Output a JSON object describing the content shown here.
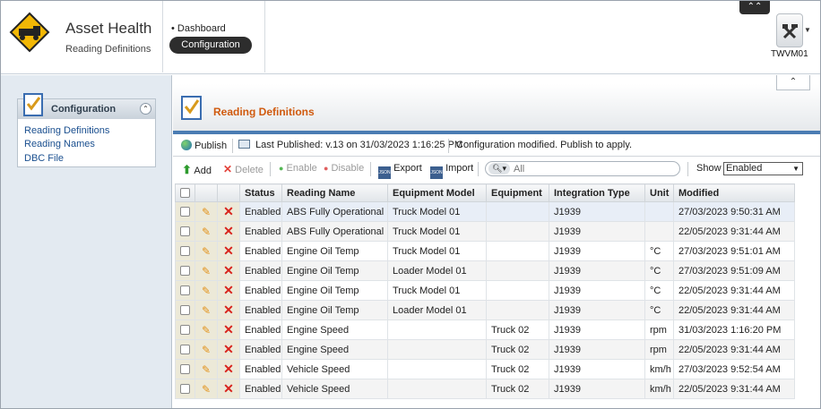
{
  "header": {
    "app_title": "Asset Health",
    "app_subtitle": "Reading Definitions",
    "nav": [
      {
        "label": "Dashboard"
      },
      {
        "label": "Configuration"
      }
    ],
    "collapse_icon": "chevron-double-up-icon",
    "user": {
      "name": "TWVM01",
      "icon": "tools-icon"
    }
  },
  "sidebar": {
    "title": "Configuration",
    "links": [
      {
        "label": "Reading Definitions"
      },
      {
        "label": "Reading Names"
      },
      {
        "label": "DBC File"
      }
    ]
  },
  "main": {
    "title": "Reading Definitions",
    "publish_bar": {
      "publish_label": "Publish",
      "last_published": "Last Published: v.13 on 31/03/2023 1:16:25 PM",
      "status_message": "Configuration modified. Publish to apply."
    },
    "toolbar": {
      "add": "Add",
      "delete": "Delete",
      "enable": "Enable",
      "disable": "Disable",
      "export": "Export",
      "import": "Import",
      "search_placeholder": "All",
      "show_label": "Show",
      "show_value": "Enabled"
    },
    "table": {
      "columns": [
        "Status",
        "Reading Name",
        "Equipment Model",
        "Equipment",
        "Integration Type",
        "Unit",
        "Modified"
      ],
      "rows": [
        {
          "status": "Enabled",
          "name": "ABS Fully Operational",
          "model": "Truck Model 01",
          "equipment": "",
          "type": "J1939",
          "unit": "",
          "modified": "27/03/2023 9:50:31 AM"
        },
        {
          "status": "Enabled",
          "name": "ABS Fully Operational",
          "model": "Truck Model 01",
          "equipment": "",
          "type": "J1939",
          "unit": "",
          "modified": "22/05/2023 9:31:44 AM"
        },
        {
          "status": "Enabled",
          "name": "Engine Oil Temp",
          "model": "Truck Model 01",
          "equipment": "",
          "type": "J1939",
          "unit": "°C",
          "modified": "27/03/2023 9:51:01 AM"
        },
        {
          "status": "Enabled",
          "name": "Engine Oil Temp",
          "model": "Loader Model 01",
          "equipment": "",
          "type": "J1939",
          "unit": "°C",
          "modified": "27/03/2023 9:51:09 AM"
        },
        {
          "status": "Enabled",
          "name": "Engine Oil Temp",
          "model": "Truck Model 01",
          "equipment": "",
          "type": "J1939",
          "unit": "°C",
          "modified": "22/05/2023 9:31:44 AM"
        },
        {
          "status": "Enabled",
          "name": "Engine Oil Temp",
          "model": "Loader Model 01",
          "equipment": "",
          "type": "J1939",
          "unit": "°C",
          "modified": "22/05/2023 9:31:44 AM"
        },
        {
          "status": "Enabled",
          "name": "Engine Speed",
          "model": "",
          "equipment": "Truck 02",
          "type": "J1939",
          "unit": "rpm",
          "modified": "31/03/2023 1:16:20 PM"
        },
        {
          "status": "Enabled",
          "name": "Engine Speed",
          "model": "",
          "equipment": "Truck 02",
          "type": "J1939",
          "unit": "rpm",
          "modified": "22/05/2023 9:31:44 AM"
        },
        {
          "status": "Enabled",
          "name": "Vehicle Speed",
          "model": "",
          "equipment": "Truck 02",
          "type": "J1939",
          "unit": "km/h",
          "modified": "27/03/2023 9:52:54 AM"
        },
        {
          "status": "Enabled",
          "name": "Vehicle Speed",
          "model": "",
          "equipment": "Truck 02",
          "type": "J1939",
          "unit": "km/h",
          "modified": "22/05/2023 9:31:44 AM"
        }
      ]
    }
  }
}
